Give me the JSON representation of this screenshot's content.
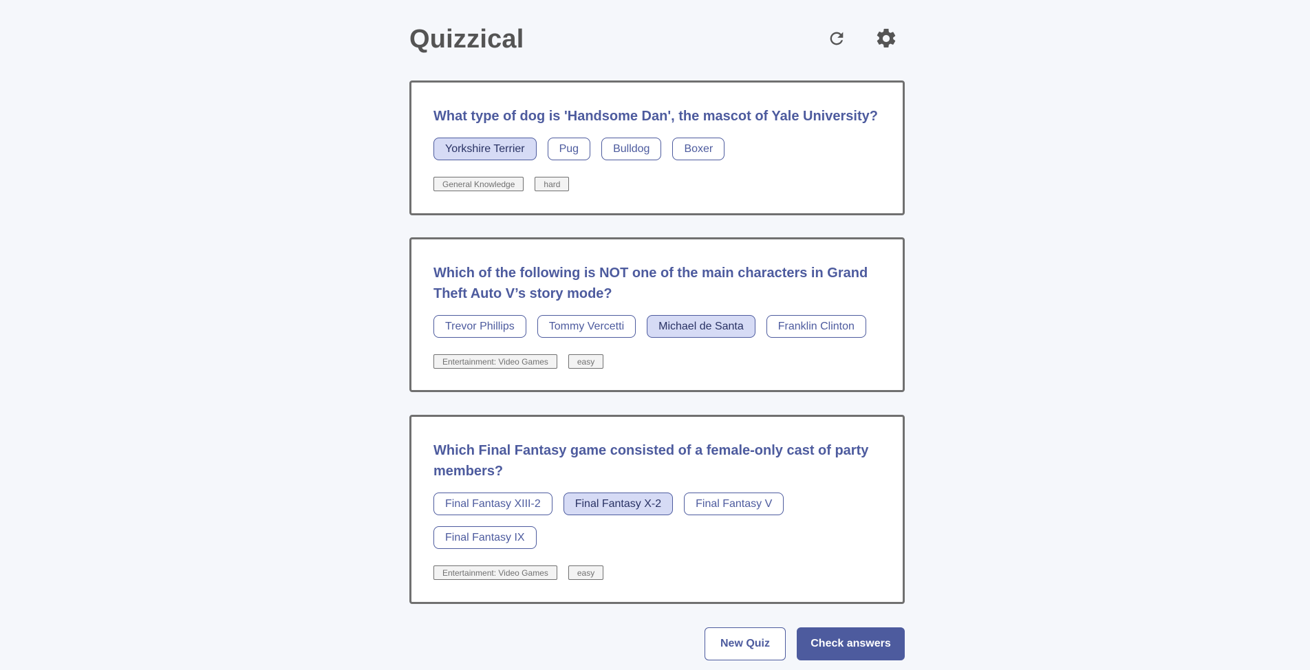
{
  "app": {
    "title": "Quizzical",
    "icons": {
      "refresh": "refresh-icon",
      "settings": "gear-icon"
    }
  },
  "questions": [
    {
      "text": "What type of dog is 'Handsome Dan', the mascot of Yale University?",
      "answers": [
        "Yorkshire Terrier",
        "Pug",
        "Bulldog",
        "Boxer"
      ],
      "selected_index": 0,
      "category": "General Knowledge",
      "difficulty": "hard"
    },
    {
      "text": "Which of the following is NOT one of the main characters in Grand Theft Auto V’s story mode?",
      "answers": [
        "Trevor Phillips",
        "Tommy Vercetti",
        "Michael de Santa",
        "Franklin Clinton"
      ],
      "selected_index": 2,
      "category": "Entertainment: Video Games",
      "difficulty": "easy"
    },
    {
      "text": "Which Final Fantasy game consisted of a female-only cast of party members?",
      "answers": [
        "Final Fantasy XIII-2",
        "Final Fantasy X-2",
        "Final Fantasy V",
        "Final Fantasy IX"
      ],
      "selected_index": 1,
      "category": "Entertainment: Video Games",
      "difficulty": "easy"
    }
  ],
  "footer": {
    "new_quiz_label": "New Quiz",
    "check_answers_label": "Check answers"
  },
  "colors": {
    "background": "#f5f7fb",
    "primary": "#4d5b9e",
    "selected_fill": "#d6dbf5",
    "title_gray": "#545454",
    "border_gray": "#707070"
  }
}
